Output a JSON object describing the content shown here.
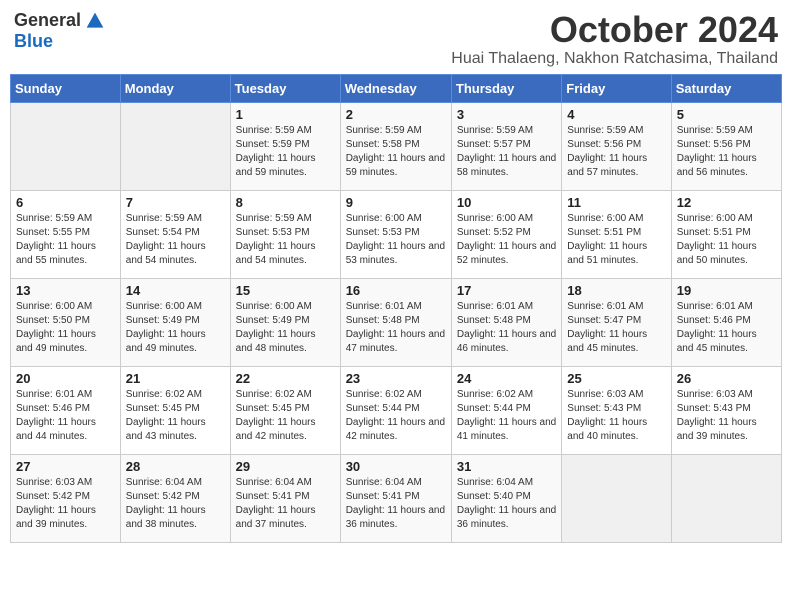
{
  "logo": {
    "general": "General",
    "blue": "Blue"
  },
  "title": "October 2024",
  "location": "Huai Thalaeng, Nakhon Ratchasima, Thailand",
  "headers": [
    "Sunday",
    "Monday",
    "Tuesday",
    "Wednesday",
    "Thursday",
    "Friday",
    "Saturday"
  ],
  "weeks": [
    [
      {
        "day": "",
        "info": ""
      },
      {
        "day": "",
        "info": ""
      },
      {
        "day": "1",
        "info": "Sunrise: 5:59 AM\nSunset: 5:59 PM\nDaylight: 11 hours and 59 minutes."
      },
      {
        "day": "2",
        "info": "Sunrise: 5:59 AM\nSunset: 5:58 PM\nDaylight: 11 hours and 59 minutes."
      },
      {
        "day": "3",
        "info": "Sunrise: 5:59 AM\nSunset: 5:57 PM\nDaylight: 11 hours and 58 minutes."
      },
      {
        "day": "4",
        "info": "Sunrise: 5:59 AM\nSunset: 5:56 PM\nDaylight: 11 hours and 57 minutes."
      },
      {
        "day": "5",
        "info": "Sunrise: 5:59 AM\nSunset: 5:56 PM\nDaylight: 11 hours and 56 minutes."
      }
    ],
    [
      {
        "day": "6",
        "info": "Sunrise: 5:59 AM\nSunset: 5:55 PM\nDaylight: 11 hours and 55 minutes."
      },
      {
        "day": "7",
        "info": "Sunrise: 5:59 AM\nSunset: 5:54 PM\nDaylight: 11 hours and 54 minutes."
      },
      {
        "day": "8",
        "info": "Sunrise: 5:59 AM\nSunset: 5:53 PM\nDaylight: 11 hours and 54 minutes."
      },
      {
        "day": "9",
        "info": "Sunrise: 6:00 AM\nSunset: 5:53 PM\nDaylight: 11 hours and 53 minutes."
      },
      {
        "day": "10",
        "info": "Sunrise: 6:00 AM\nSunset: 5:52 PM\nDaylight: 11 hours and 52 minutes."
      },
      {
        "day": "11",
        "info": "Sunrise: 6:00 AM\nSunset: 5:51 PM\nDaylight: 11 hours and 51 minutes."
      },
      {
        "day": "12",
        "info": "Sunrise: 6:00 AM\nSunset: 5:51 PM\nDaylight: 11 hours and 50 minutes."
      }
    ],
    [
      {
        "day": "13",
        "info": "Sunrise: 6:00 AM\nSunset: 5:50 PM\nDaylight: 11 hours and 49 minutes."
      },
      {
        "day": "14",
        "info": "Sunrise: 6:00 AM\nSunset: 5:49 PM\nDaylight: 11 hours and 49 minutes."
      },
      {
        "day": "15",
        "info": "Sunrise: 6:00 AM\nSunset: 5:49 PM\nDaylight: 11 hours and 48 minutes."
      },
      {
        "day": "16",
        "info": "Sunrise: 6:01 AM\nSunset: 5:48 PM\nDaylight: 11 hours and 47 minutes."
      },
      {
        "day": "17",
        "info": "Sunrise: 6:01 AM\nSunset: 5:48 PM\nDaylight: 11 hours and 46 minutes."
      },
      {
        "day": "18",
        "info": "Sunrise: 6:01 AM\nSunset: 5:47 PM\nDaylight: 11 hours and 45 minutes."
      },
      {
        "day": "19",
        "info": "Sunrise: 6:01 AM\nSunset: 5:46 PM\nDaylight: 11 hours and 45 minutes."
      }
    ],
    [
      {
        "day": "20",
        "info": "Sunrise: 6:01 AM\nSunset: 5:46 PM\nDaylight: 11 hours and 44 minutes."
      },
      {
        "day": "21",
        "info": "Sunrise: 6:02 AM\nSunset: 5:45 PM\nDaylight: 11 hours and 43 minutes."
      },
      {
        "day": "22",
        "info": "Sunrise: 6:02 AM\nSunset: 5:45 PM\nDaylight: 11 hours and 42 minutes."
      },
      {
        "day": "23",
        "info": "Sunrise: 6:02 AM\nSunset: 5:44 PM\nDaylight: 11 hours and 42 minutes."
      },
      {
        "day": "24",
        "info": "Sunrise: 6:02 AM\nSunset: 5:44 PM\nDaylight: 11 hours and 41 minutes."
      },
      {
        "day": "25",
        "info": "Sunrise: 6:03 AM\nSunset: 5:43 PM\nDaylight: 11 hours and 40 minutes."
      },
      {
        "day": "26",
        "info": "Sunrise: 6:03 AM\nSunset: 5:43 PM\nDaylight: 11 hours and 39 minutes."
      }
    ],
    [
      {
        "day": "27",
        "info": "Sunrise: 6:03 AM\nSunset: 5:42 PM\nDaylight: 11 hours and 39 minutes."
      },
      {
        "day": "28",
        "info": "Sunrise: 6:04 AM\nSunset: 5:42 PM\nDaylight: 11 hours and 38 minutes."
      },
      {
        "day": "29",
        "info": "Sunrise: 6:04 AM\nSunset: 5:41 PM\nDaylight: 11 hours and 37 minutes."
      },
      {
        "day": "30",
        "info": "Sunrise: 6:04 AM\nSunset: 5:41 PM\nDaylight: 11 hours and 36 minutes."
      },
      {
        "day": "31",
        "info": "Sunrise: 6:04 AM\nSunset: 5:40 PM\nDaylight: 11 hours and 36 minutes."
      },
      {
        "day": "",
        "info": ""
      },
      {
        "day": "",
        "info": ""
      }
    ]
  ]
}
